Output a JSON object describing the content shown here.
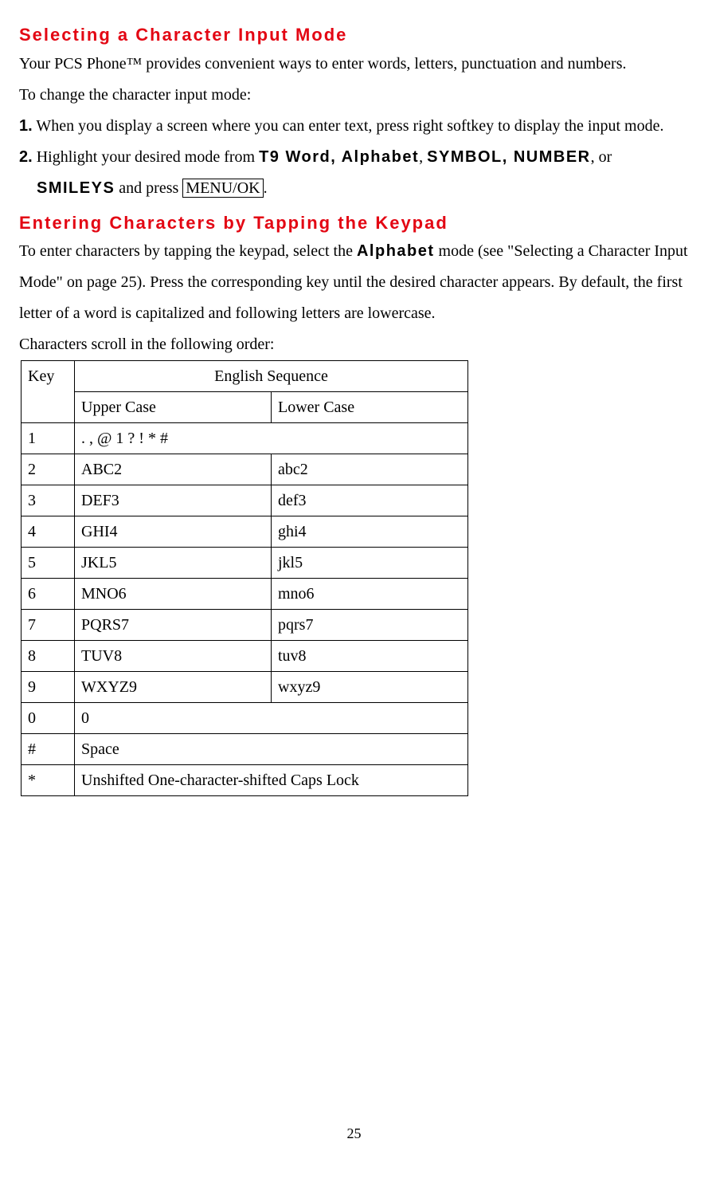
{
  "heading1": "Selecting a Character Input Mode",
  "para1": "Your PCS Phone™ provides convenient ways to enter words, letters, punctuation and numbers.",
  "para1b": "To change the character input mode:",
  "step1_num": "1.",
  "step1_text": " When you display a screen where you can enter text, press right softkey to display the input mode.",
  "step2_num": "2.",
  "step2_textA": " Highlight your desired mode from ",
  "step2_mode1": "T9 Word, Alphabet",
  "step2_comma1": ", ",
  "step2_mode2": "SYMBOL, NUMBER",
  "step2_comma2": ", or ",
  "step2_mode3": "SMILEYS",
  "step2_textB": " and press ",
  "step2_button": "MENU/OK",
  "step2_period": ".",
  "heading2": "Entering Characters by Tapping the Keypad",
  "para2a": "To enter characters by tapping the keypad, select the ",
  "para2_bold": "Alphabet",
  "para2b": " mode (see \"Selecting a Character Input Mode\" on page 25). Press the corresponding key until the desired character appears. By default, the first letter of a word is capitalized and following letters are lowercase.",
  "para3": "Characters scroll in the following order:",
  "table": {
    "h_key": "Key",
    "h_seq": "English Sequence",
    "h_upper": "Upper Case",
    "h_lower": "Lower Case",
    "rows": [
      {
        "key": "1",
        "span": ". , @ 1 ? ! * #"
      },
      {
        "key": "2",
        "upper": "ABC2",
        "lower": "abc2"
      },
      {
        "key": "3",
        "upper": "DEF3",
        "lower": "def3"
      },
      {
        "key": "4",
        "upper": "GHI4",
        "lower": "ghi4"
      },
      {
        "key": "5",
        "upper": "JKL5",
        "lower": "jkl5"
      },
      {
        "key": "6",
        "upper": "MNO6",
        "lower": "mno6"
      },
      {
        "key": "7",
        "upper": "PQRS7",
        "lower": "pqrs7"
      },
      {
        "key": "8",
        "upper": "TUV8",
        "lower": "tuv8"
      },
      {
        "key": "9",
        "upper": "WXYZ9",
        "lower": "wxyz9"
      },
      {
        "key": "0",
        "span": "0"
      },
      {
        "key": "#",
        "span": "Space"
      },
      {
        "key": "*",
        "span": "Unshifted One-character-shifted   Caps  Lock"
      }
    ]
  },
  "pagenum": "25"
}
